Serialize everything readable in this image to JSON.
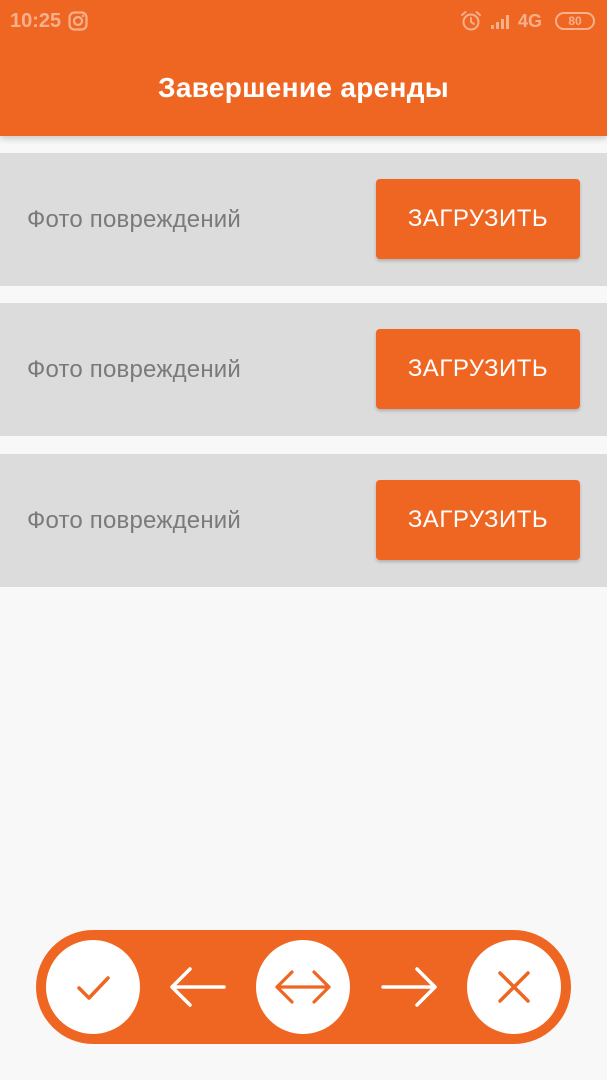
{
  "colors": {
    "accent": "#ef6622",
    "row_background": "#dcdcdc",
    "page_background": "#f8f8f8",
    "label_text": "#7a7a7a",
    "status_text": "#f6b18c"
  },
  "status_bar": {
    "time": "10:25",
    "network": "4G",
    "battery": "80",
    "icons": [
      "instagram-icon",
      "alarm-icon",
      "signal-icon"
    ]
  },
  "header": {
    "title": "Завершение аренды"
  },
  "rows": [
    {
      "label": "Фото повреждений",
      "button_label": "ЗАГРУЗИТЬ"
    },
    {
      "label": "Фото повреждений",
      "button_label": "ЗАГРУЗИТЬ"
    },
    {
      "label": "Фото повреждений",
      "button_label": "ЗАГРУЗИТЬ"
    }
  ],
  "bottom_toolbar": {
    "buttons": [
      "check-icon",
      "arrow-left-icon",
      "arrow-left-right-icon",
      "arrow-right-icon",
      "close-icon"
    ]
  }
}
